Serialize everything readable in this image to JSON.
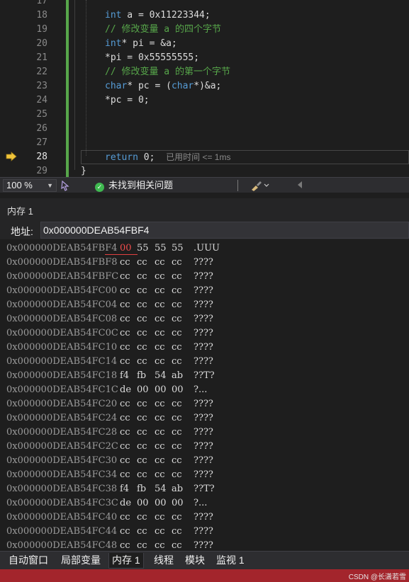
{
  "editor": {
    "lines": [
      {
        "number": "17",
        "segments": []
      },
      {
        "number": "18",
        "segments": [
          {
            "t": "int",
            "c": "kw"
          },
          {
            "t": " a = 0x11223344;",
            "c": ""
          }
        ]
      },
      {
        "number": "19",
        "segments": [
          {
            "t": "// 修改变量 a 的四个字节",
            "c": "cm"
          }
        ]
      },
      {
        "number": "20",
        "segments": [
          {
            "t": "int",
            "c": "kw"
          },
          {
            "t": "* pi = &a;",
            "c": ""
          }
        ]
      },
      {
        "number": "21",
        "segments": [
          {
            "t": "*pi = 0x55555555;",
            "c": ""
          }
        ]
      },
      {
        "number": "22",
        "segments": [
          {
            "t": "// 修改变量 a 的第一个字节",
            "c": "cm"
          }
        ]
      },
      {
        "number": "23",
        "segments": [
          {
            "t": "char",
            "c": "kw"
          },
          {
            "t": "* pc = (",
            "c": ""
          },
          {
            "t": "char",
            "c": "kw"
          },
          {
            "t": "*)&a;",
            "c": ""
          }
        ]
      },
      {
        "number": "24",
        "segments": [
          {
            "t": "*pc = 0;",
            "c": ""
          }
        ]
      },
      {
        "number": "25",
        "segments": []
      },
      {
        "number": "26",
        "segments": []
      },
      {
        "number": "27",
        "segments": []
      },
      {
        "number": "28",
        "segments": [
          {
            "t": "return",
            "c": "kw"
          },
          {
            "t": " 0;",
            "c": ""
          }
        ],
        "current": true,
        "perf_tip": "已用时间 <= 1ms"
      },
      {
        "number": "29",
        "segments": [
          {
            "t": "}",
            "c": ""
          }
        ],
        "brace": true
      }
    ]
  },
  "status": {
    "zoom": "100 %",
    "issues": "未找到相关问题"
  },
  "memory": {
    "title": "内存 1",
    "address_label": "地址:",
    "address_value": "0x000000DEAB54FBF4",
    "rows": [
      {
        "addr": "0x000000DEAB54FBF4",
        "bytes": [
          "00",
          "55",
          "55",
          "55"
        ],
        "ascii": ".UUU",
        "changed": [
          0
        ]
      },
      {
        "addr": "0x000000DEAB54FBF8",
        "bytes": [
          "cc",
          "cc",
          "cc",
          "cc"
        ],
        "ascii": "????"
      },
      {
        "addr": "0x000000DEAB54FBFC",
        "bytes": [
          "cc",
          "cc",
          "cc",
          "cc"
        ],
        "ascii": "????"
      },
      {
        "addr": "0x000000DEAB54FC00",
        "bytes": [
          "cc",
          "cc",
          "cc",
          "cc"
        ],
        "ascii": "????"
      },
      {
        "addr": "0x000000DEAB54FC04",
        "bytes": [
          "cc",
          "cc",
          "cc",
          "cc"
        ],
        "ascii": "????"
      },
      {
        "addr": "0x000000DEAB54FC08",
        "bytes": [
          "cc",
          "cc",
          "cc",
          "cc"
        ],
        "ascii": "????"
      },
      {
        "addr": "0x000000DEAB54FC0C",
        "bytes": [
          "cc",
          "cc",
          "cc",
          "cc"
        ],
        "ascii": "????"
      },
      {
        "addr": "0x000000DEAB54FC10",
        "bytes": [
          "cc",
          "cc",
          "cc",
          "cc"
        ],
        "ascii": "????"
      },
      {
        "addr": "0x000000DEAB54FC14",
        "bytes": [
          "cc",
          "cc",
          "cc",
          "cc"
        ],
        "ascii": "????"
      },
      {
        "addr": "0x000000DEAB54FC18",
        "bytes": [
          "f4",
          "fb",
          "54",
          "ab"
        ],
        "ascii": "??T?"
      },
      {
        "addr": "0x000000DEAB54FC1C",
        "bytes": [
          "de",
          "00",
          "00",
          "00"
        ],
        "ascii": "?..."
      },
      {
        "addr": "0x000000DEAB54FC20",
        "bytes": [
          "cc",
          "cc",
          "cc",
          "cc"
        ],
        "ascii": "????"
      },
      {
        "addr": "0x000000DEAB54FC24",
        "bytes": [
          "cc",
          "cc",
          "cc",
          "cc"
        ],
        "ascii": "????"
      },
      {
        "addr": "0x000000DEAB54FC28",
        "bytes": [
          "cc",
          "cc",
          "cc",
          "cc"
        ],
        "ascii": "????"
      },
      {
        "addr": "0x000000DEAB54FC2C",
        "bytes": [
          "cc",
          "cc",
          "cc",
          "cc"
        ],
        "ascii": "????"
      },
      {
        "addr": "0x000000DEAB54FC30",
        "bytes": [
          "cc",
          "cc",
          "cc",
          "cc"
        ],
        "ascii": "????"
      },
      {
        "addr": "0x000000DEAB54FC34",
        "bytes": [
          "cc",
          "cc",
          "cc",
          "cc"
        ],
        "ascii": "????"
      },
      {
        "addr": "0x000000DEAB54FC38",
        "bytes": [
          "f4",
          "fb",
          "54",
          "ab"
        ],
        "ascii": "??T?"
      },
      {
        "addr": "0x000000DEAB54FC3C",
        "bytes": [
          "de",
          "00",
          "00",
          "00"
        ],
        "ascii": "?..."
      },
      {
        "addr": "0x000000DEAB54FC40",
        "bytes": [
          "cc",
          "cc",
          "cc",
          "cc"
        ],
        "ascii": "????"
      },
      {
        "addr": "0x000000DEAB54FC44",
        "bytes": [
          "cc",
          "cc",
          "cc",
          "cc"
        ],
        "ascii": "????"
      },
      {
        "addr": "0x000000DEAB54FC48",
        "bytes": [
          "cc",
          "cc",
          "cc",
          "cc"
        ],
        "ascii": "????"
      }
    ]
  },
  "tabs": [
    {
      "label": "自动窗口",
      "active": false
    },
    {
      "label": "局部变量",
      "active": false
    },
    {
      "label": "内存 1",
      "active": true
    },
    {
      "label": "线程",
      "active": false
    },
    {
      "label": "模块",
      "active": false
    },
    {
      "label": "监视 1",
      "active": false
    }
  ],
  "watermark": "CSDN @长潇若雪",
  "colors": {
    "keyword": "#569cd6",
    "comment": "#57a64a",
    "change_bar": "#57a64a",
    "changed_byte": "#f14c4c",
    "exec_arrow": "#f0c43a",
    "statusbar": "#a3252c"
  },
  "icons": {
    "exec_pointer": "arrow-right-icon",
    "issues": "check-circle-icon",
    "cleanup": "brush-icon"
  }
}
